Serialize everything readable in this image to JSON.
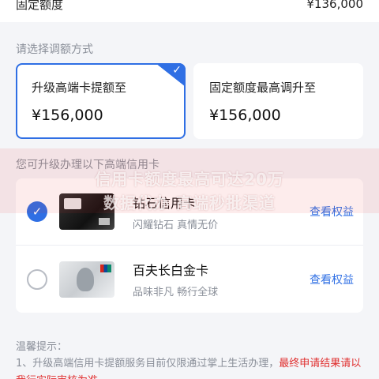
{
  "header": {
    "label": "固定额度",
    "value": "¥136,000"
  },
  "adjust": {
    "title": "请选择调额方式",
    "options": [
      {
        "title": "升级高端卡提额至",
        "amount": "¥156,000",
        "selected": true
      },
      {
        "title": "固定额度最高调升至",
        "amount": "¥156,000",
        "selected": false
      }
    ]
  },
  "cards": {
    "title": "您可升级办理以下高端信用卡",
    "items": [
      {
        "name": "钻石信用卡",
        "desc": "闪耀钻石 真情无价",
        "benefits": "查看权益",
        "selected": true
      },
      {
        "name": "百夫长白金卡",
        "desc": "品味非凡 畅行全球",
        "benefits": "查看权益",
        "selected": false
      }
    ]
  },
  "banner": {
    "line1": "信用卡额度最高可达20万",
    "line2": "数据代办 高端秒批渠道"
  },
  "tips": {
    "title": "温馨提示：",
    "line1_prefix": "1、升级高端信用卡提额服务目前仅限通过掌上生活办理，",
    "line1_highlight": "最终申请结果请以我行实际审核为准"
  },
  "colors": {
    "accent": "#2f6fe4",
    "warning": "#e02e2e",
    "muted": "#8a8f99"
  }
}
